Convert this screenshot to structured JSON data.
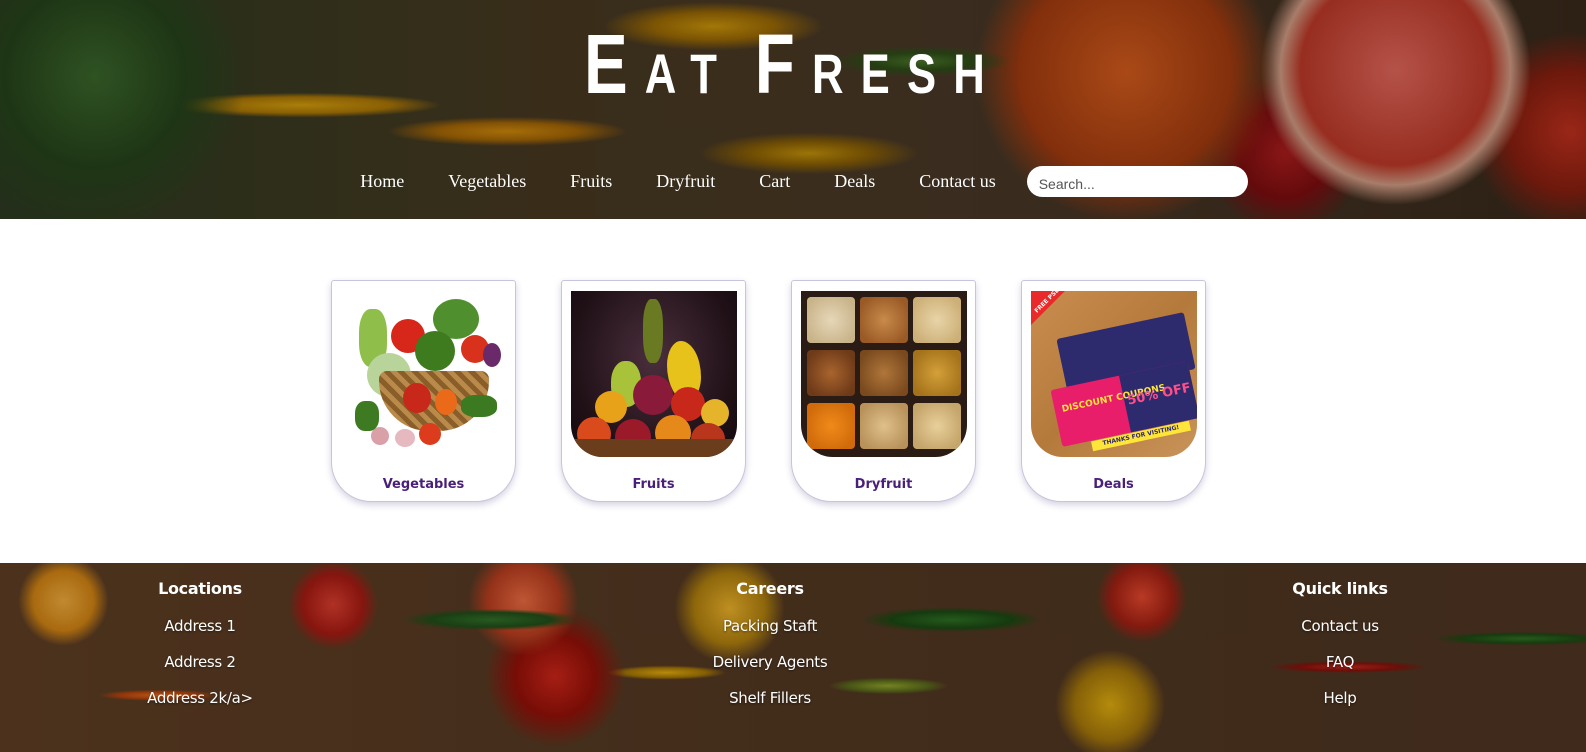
{
  "header": {
    "brand": {
      "word1_initial": "E",
      "word1_rest": "at",
      "word2_initial": "F",
      "word2_rest": "resh"
    },
    "nav": [
      "Home",
      "Vegetables",
      "Fruits",
      "Dryfruit",
      "Cart",
      "Deals",
      "Contact us"
    ],
    "search": {
      "placeholder": "Search...",
      "value": ""
    }
  },
  "categories": [
    {
      "label": "Vegetables",
      "image": "vegetable-basket"
    },
    {
      "label": "Fruits",
      "image": "fruit-pile"
    },
    {
      "label": "Dryfruit",
      "image": "dryfruit-box"
    },
    {
      "label": "Deals",
      "image": "discount-coupons"
    }
  ],
  "coupon_text": {
    "headline": "DISCOUNT COUPONS",
    "offer": "50% OFF",
    "tag": "FREE PSD",
    "thanks": "THANKS FOR VISITING!"
  },
  "footer": {
    "locations": {
      "title": "Locations",
      "links": [
        "Address 1",
        "Address 2",
        "Address 2k/a>"
      ]
    },
    "careers": {
      "title": "Careers",
      "links": [
        "Packing Staft",
        "Delivery Agents",
        "Shelf Fillers"
      ]
    },
    "quick_links": {
      "title": "Quick links",
      "links": [
        "Contact us",
        "FAQ",
        "Help"
      ]
    }
  },
  "colors": {
    "card_label": "#4a1f7a",
    "text_on_image": "#ffffff"
  }
}
